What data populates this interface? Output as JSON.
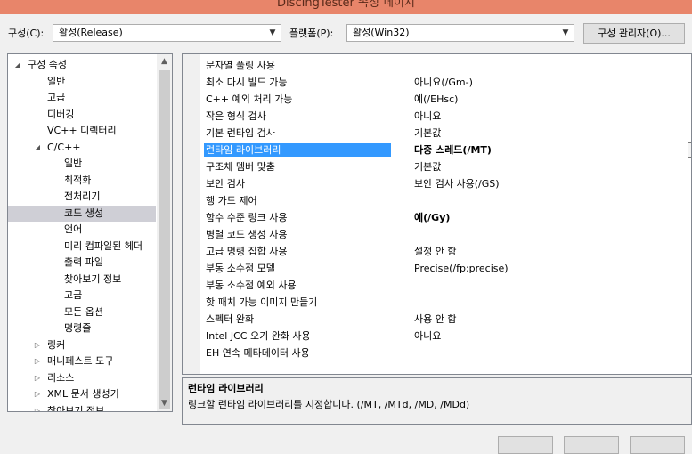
{
  "window": {
    "title": "DiscIngTester 속성 페이지"
  },
  "toolbar": {
    "config_label": "구성(C):",
    "config_value": "활성(Release)",
    "platform_label": "플랫폼(P):",
    "platform_value": "활성(Win32)",
    "config_manager_label": "구성 관리자(O)..."
  },
  "tree": {
    "items": [
      {
        "label": "구성 속성",
        "indent": 1,
        "toggle": "◢"
      },
      {
        "label": "일반",
        "indent": 2
      },
      {
        "label": "고급",
        "indent": 2
      },
      {
        "label": "디버깅",
        "indent": 2
      },
      {
        "label": "VC++ 디렉터리",
        "indent": 2
      },
      {
        "label": "C/C++",
        "indent": 2,
        "toggle": "◢"
      },
      {
        "label": "일반",
        "indent": 3
      },
      {
        "label": "최적화",
        "indent": 3
      },
      {
        "label": "전처리기",
        "indent": 3
      },
      {
        "label": "코드 생성",
        "indent": 3,
        "selected": true
      },
      {
        "label": "언어",
        "indent": 3
      },
      {
        "label": "미리 컴파일된 헤더",
        "indent": 3
      },
      {
        "label": "출력 파일",
        "indent": 3
      },
      {
        "label": "찾아보기 정보",
        "indent": 3
      },
      {
        "label": "고급",
        "indent": 3
      },
      {
        "label": "모든 옵션",
        "indent": 3
      },
      {
        "label": "명령줄",
        "indent": 3
      },
      {
        "label": "링커",
        "indent": 2,
        "toggle": "▷"
      },
      {
        "label": "매니페스트 도구",
        "indent": 2,
        "toggle": "▷"
      },
      {
        "label": "리소스",
        "indent": 2,
        "toggle": "▷"
      },
      {
        "label": "XML 문서 생성기",
        "indent": 2,
        "toggle": "▷"
      },
      {
        "label": "찾아보기 정보",
        "indent": 2,
        "toggle": "▷"
      }
    ]
  },
  "grid": {
    "rows": [
      {
        "name": "문자열 풀링 사용",
        "value": ""
      },
      {
        "name": "최소 다시 빌드 가능",
        "value": "아니요(/Gm-)"
      },
      {
        "name": "C++ 예외 처리 가능",
        "value": "예(/EHsc)"
      },
      {
        "name": "작은 형식 검사",
        "value": "아니요"
      },
      {
        "name": "기본 런타임 검사",
        "value": "기본값"
      },
      {
        "name": "런타임 라이브러리",
        "value": "다중 스레드(/MT)",
        "selected": true
      },
      {
        "name": "구조체 멤버 맞춤",
        "value": "기본값"
      },
      {
        "name": "보안 검사",
        "value": "보안 검사 사용(/GS)"
      },
      {
        "name": "행 가드 제어",
        "value": ""
      },
      {
        "name": "함수 수준 링크 사용",
        "value": "예(/Gy)",
        "bold": true
      },
      {
        "name": "병렬 코드 생성 사용",
        "value": ""
      },
      {
        "name": "고급 명령 집합 사용",
        "value": "설정 안 함"
      },
      {
        "name": "부동 소수점 모델",
        "value": "Precise(/fp:precise)"
      },
      {
        "name": "부동 소수점 예외 사용",
        "value": ""
      },
      {
        "name": "핫 패치 가능 이미지 만들기",
        "value": ""
      },
      {
        "name": "스펙터 완화",
        "value": "사용 안 함"
      },
      {
        "name": "Intel JCC 오기 완화 사용",
        "value": "아니요"
      },
      {
        "name": "EH 연속 메타데이터 사용",
        "value": ""
      }
    ]
  },
  "description": {
    "title": "런타임 라이브러리",
    "text": "링크할 런타임 라이브러리를 지정합니다.     (/MT, /MTd, /MD, /MDd)"
  }
}
